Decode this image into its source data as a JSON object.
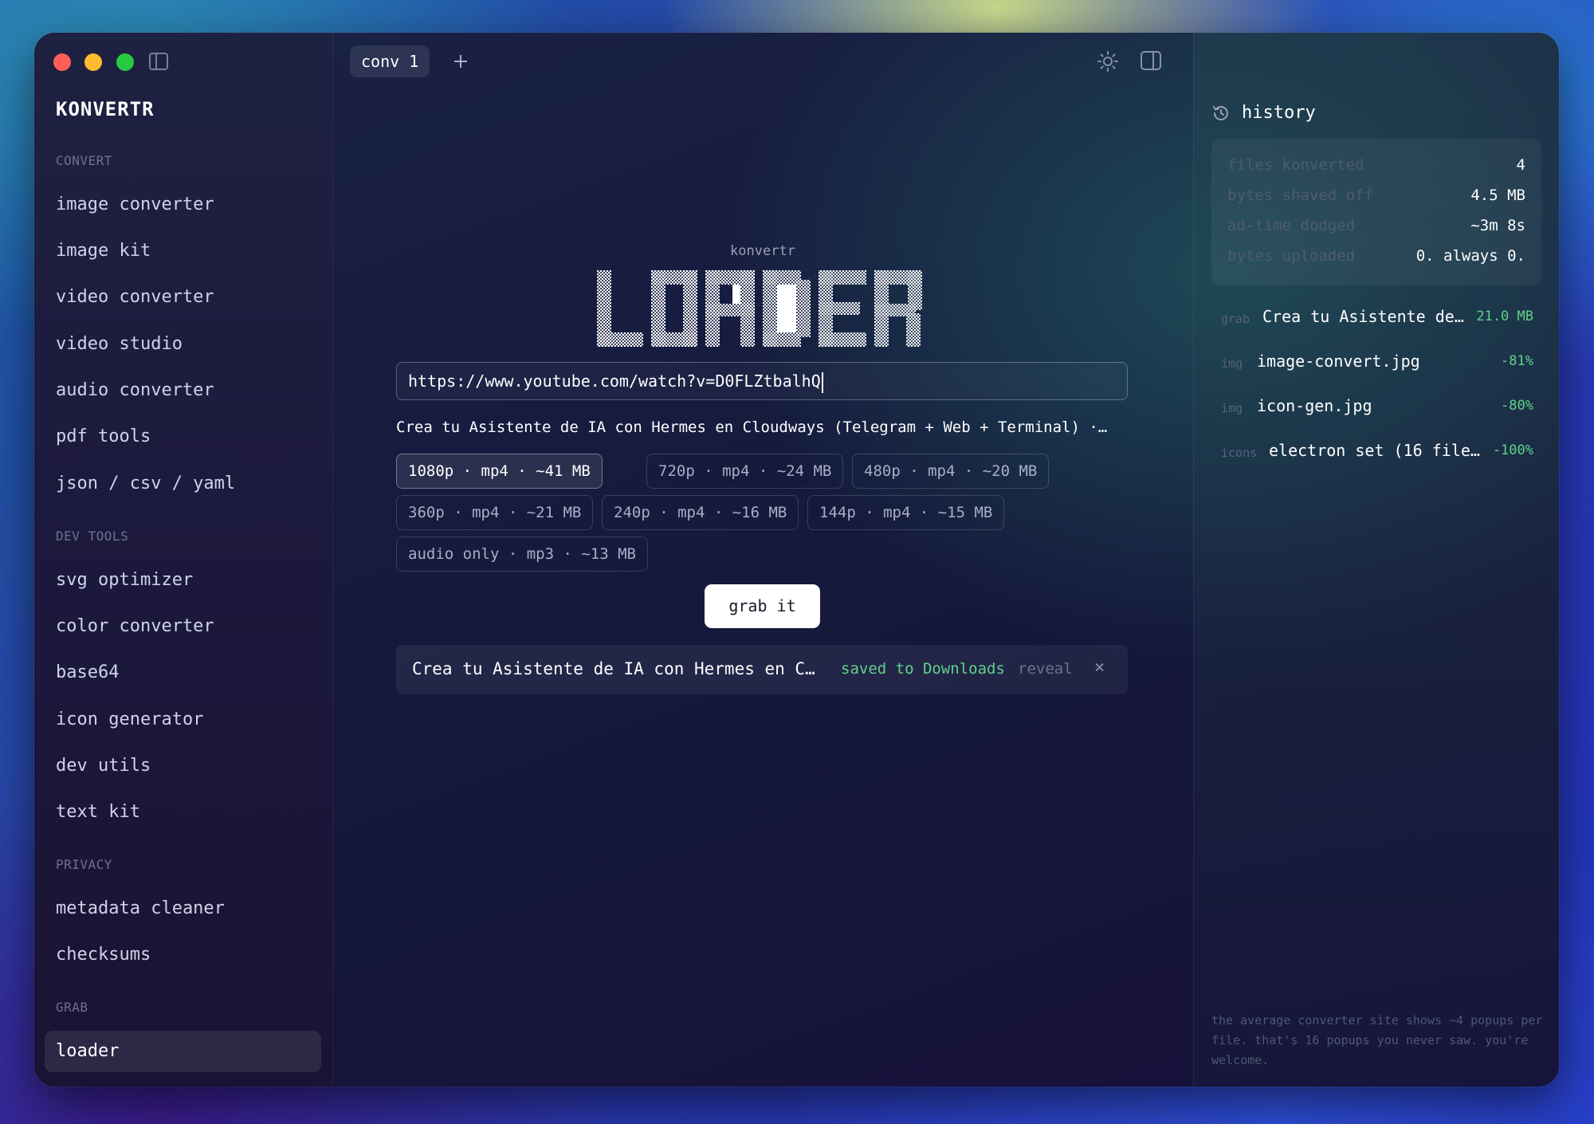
{
  "app": {
    "name": "KONVERTR"
  },
  "sidebar": {
    "sections": [
      {
        "heading": "CONVERT",
        "items": [
          "image converter",
          "image kit",
          "video converter",
          "video studio",
          "audio converter",
          "pdf tools",
          "json / csv / yaml"
        ]
      },
      {
        "heading": "DEV TOOLS",
        "items": [
          "svg optimizer",
          "color converter",
          "base64",
          "icon generator",
          "dev utils",
          "text kit"
        ]
      },
      {
        "heading": "PRIVACY",
        "items": [
          "metadata cleaner",
          "checksums"
        ]
      },
      {
        "heading": "GRAB",
        "items": [
          "loader"
        ]
      }
    ],
    "active_item": "loader"
  },
  "tabs": [
    {
      "label": "conv 1"
    }
  ],
  "main": {
    "brand_small": "konvertr",
    "logo_text": "LOADER",
    "url_value": "https://www.youtube.com/watch?v=D0FLZtbalhQ",
    "video_title": "Crea tu Asistente de IA con Hermes en Cloudways (Telegram + Web + Terminal) ·…",
    "formats": [
      "1080p · mp4 · ~41 MB",
      "720p · mp4 · ~24 MB",
      "480p · mp4 · ~20 MB",
      "360p · mp4 · ~21 MB",
      "240p · mp4 · ~16 MB",
      "144p · mp4 · ~15 MB",
      "audio only · mp3 · ~13 MB"
    ],
    "selected_format": "1080p · mp4 · ~41 MB",
    "grab_label": "grab it",
    "result": {
      "name": "Crea tu Asistente de IA con Hermes en C…",
      "status": "saved to Downloads",
      "reveal_label": "reveal",
      "close_symbol": "×"
    }
  },
  "history": {
    "title": "history",
    "stats": [
      {
        "label": "files konverted",
        "value": "4"
      },
      {
        "label": "bytes shaved off",
        "value": "4.5 MB"
      },
      {
        "label": "ad-time dodged",
        "value": "~3m 8s"
      },
      {
        "label": "bytes uploaded",
        "value": "0. always 0."
      }
    ],
    "items": [
      {
        "tag": "grab",
        "name": "Crea tu Asistente de…",
        "value": "21.0 MB"
      },
      {
        "tag": "img",
        "name": "image-convert.jpg",
        "value": "-81%"
      },
      {
        "tag": "img",
        "name": "icon-gen.jpg",
        "value": "-80%"
      },
      {
        "tag": "icons",
        "name": "electron set (16 file…",
        "value": "-100%"
      }
    ],
    "footer_note": "the average converter site shows ~4 popups per file. that's 16 popups you never saw. you're welcome."
  },
  "colors": {
    "accent_green": "#5fd38a",
    "traffic_close": "#ff5f57",
    "traffic_min": "#febc2e",
    "traffic_max": "#28c840"
  },
  "icons": [
    "sidebar-toggle-icon",
    "plus-icon",
    "sun-icon",
    "panel-toggle-icon",
    "history-icon",
    "close-icon"
  ]
}
